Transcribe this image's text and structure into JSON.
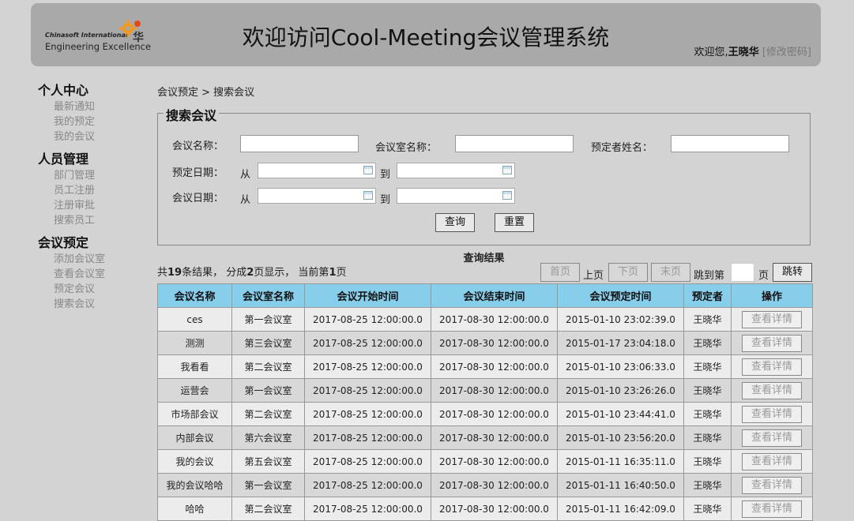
{
  "header": {
    "logo_line1": "Chinasoft International",
    "logo_line2": "Engineering Excellence",
    "title": "欢迎访问Cool-Meeting会议管理系统",
    "welcome_prefix": "欢迎您,",
    "user_name": "王晓华",
    "change_password": "[修改密码]"
  },
  "sidebar": [
    {
      "title": "个人中心",
      "items": [
        "最新通知",
        "我的预定",
        "我的会议"
      ]
    },
    {
      "title": "人员管理",
      "items": [
        "部门管理",
        "员工注册",
        "注册审批",
        "搜索员工"
      ]
    },
    {
      "title": "会议预定",
      "items": [
        "添加会议室",
        "查看会议室",
        "预定会议",
        "搜索会议"
      ]
    }
  ],
  "breadcrumb": "会议预定 > 搜索会议",
  "search": {
    "legend": "搜索会议",
    "meeting_name_label": "会议名称：",
    "room_name_label": "会议室名称：",
    "booker_label": "预定者姓名：",
    "booking_date_label": "预定日期：",
    "meeting_date_label": "会议日期：",
    "from": "从",
    "to": "到",
    "query_button": "查询",
    "reset_button": "重置"
  },
  "results": {
    "title": "查询结果",
    "summary_1": "共",
    "total": "19",
    "summary_2": "条结果， 分成",
    "pages": "2",
    "summary_3": "页显示， 当前第",
    "current": "1",
    "summary_4": "页",
    "first": "首页",
    "prev": "上页",
    "next": "下页",
    "last": "末页",
    "jump_label": "跳到第",
    "page_unit": "页",
    "jump_button": "跳转",
    "columns": [
      "会议名称",
      "会议室名称",
      "会议开始时间",
      "会议结束时间",
      "会议预定时间",
      "预定者",
      "操作"
    ],
    "detail_label": "查看详情",
    "rows": [
      [
        "ces",
        "第一会议室",
        "2017-08-25 12:00:00.0",
        "2017-08-30 12:00:00.0",
        "2015-01-10 23:02:39.0",
        "王晓华"
      ],
      [
        "测测",
        "第三会议室",
        "2017-08-25 12:00:00.0",
        "2017-08-30 12:00:00.0",
        "2015-01-17 23:04:18.0",
        "王晓华"
      ],
      [
        "我看看",
        "第二会议室",
        "2017-08-25 12:00:00.0",
        "2017-08-30 12:00:00.0",
        "2015-01-10 23:06:33.0",
        "王晓华"
      ],
      [
        "运营会",
        "第一会议室",
        "2017-08-25 12:00:00.0",
        "2017-08-30 12:00:00.0",
        "2015-01-10 23:26:26.0",
        "王晓华"
      ],
      [
        "市场部会议",
        "第二会议室",
        "2017-08-25 12:00:00.0",
        "2017-08-30 12:00:00.0",
        "2015-01-10 23:44:41.0",
        "王晓华"
      ],
      [
        "内部会议",
        "第六会议室",
        "2017-08-25 12:00:00.0",
        "2017-08-30 12:00:00.0",
        "2015-01-10 23:56:20.0",
        "王晓华"
      ],
      [
        "我的会议",
        "第五会议室",
        "2017-08-25 12:00:00.0",
        "2017-08-30 12:00:00.0",
        "2015-01-11 16:35:11.0",
        "王晓华"
      ],
      [
        "我的会议哈哈",
        "第一会议室",
        "2017-08-25 12:00:00.0",
        "2017-08-30 12:00:00.0",
        "2015-01-11 16:40:50.0",
        "王晓华"
      ],
      [
        "哈哈",
        "第二会议室",
        "2017-08-25 12:00:00.0",
        "2017-08-30 12:00:00.0",
        "2015-01-11 16:42:09.0",
        "王晓华"
      ]
    ]
  }
}
